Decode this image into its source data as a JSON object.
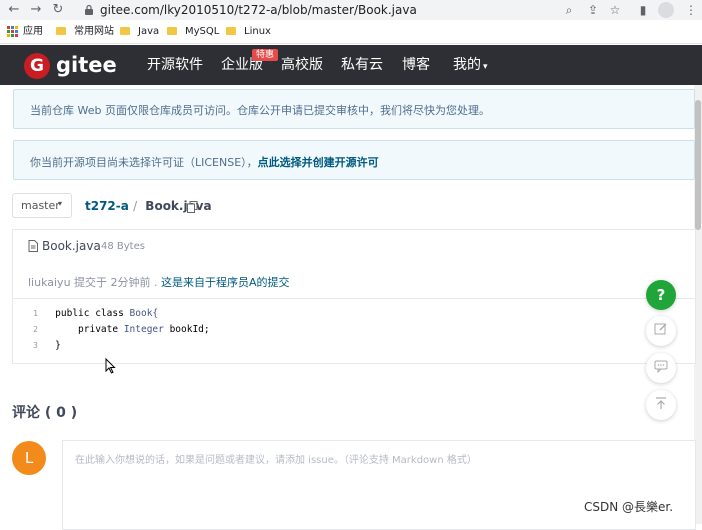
{
  "browser": {
    "url": "gitee.com/lky2010510/t272-a/blob/master/Book.java",
    "bookmarks": [
      "应用",
      "常用网站",
      "Java",
      "MySQL",
      "Linux"
    ]
  },
  "nav": {
    "logo_text": "G",
    "brand": "gitee",
    "items": [
      "开源软件",
      "企业版",
      "高校版",
      "私有云",
      "博客",
      "我的"
    ],
    "badge": "特惠"
  },
  "notices": {
    "review": "当前仓库 Web 页面仅限仓库成员可访问。仓库公开申请已提交审核中，我们将尽快为您处理。",
    "license_text": "你当前开源项目尚未选择许可证（LICENSE），",
    "license_link": "点此选择并创建开源许可"
  },
  "repo": {
    "branch": "master",
    "path_repo": "t272-a",
    "path_sep": "/",
    "path_file": "Book.java"
  },
  "file": {
    "name": "Book.java",
    "size": "48 Bytes",
    "author": "liukaiyu",
    "commit_mid": " 提交于 2分钟前 . ",
    "commit_msg": "这是来自于程序员A的提交",
    "lines": [
      {
        "n": "1",
        "parts": [
          {
            "t": "public class ",
            "c": "kw"
          },
          {
            "t": "Book{",
            "c": "type"
          }
        ]
      },
      {
        "n": "2",
        "parts": [
          {
            "t": "    private ",
            "c": "kw"
          },
          {
            "t": "Integer ",
            "c": "type"
          },
          {
            "t": "bookId;",
            "c": "kw"
          }
        ]
      },
      {
        "n": "3",
        "parts": [
          {
            "t": "}",
            "c": "kw"
          }
        ]
      }
    ]
  },
  "comments": {
    "title": "评论 ( 0 )",
    "avatar_letter": "L",
    "placeholder": "在此输入你想说的话，如果是问题或者建议，请添加 issue。（评论支持 Markdown 格式）"
  },
  "float": {
    "help": "?"
  },
  "watermark": "CSDN @長樂er.",
  "colors": {
    "nav_bg": "#2d2f34",
    "brand_red": "#c71d23",
    "help_green": "#1fa53a",
    "avatar_orange": "#f28b1b",
    "link_blue": "#005980"
  }
}
